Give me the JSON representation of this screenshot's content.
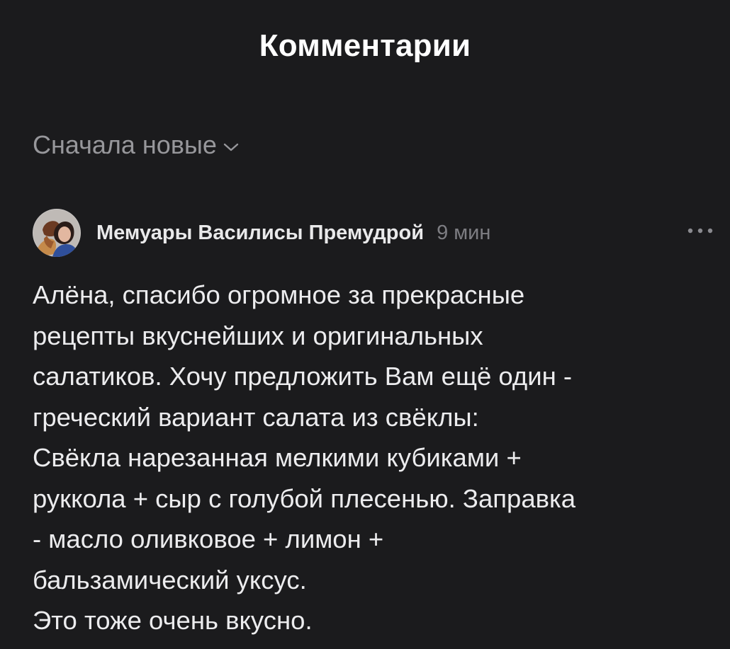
{
  "header": {
    "title": "Комментарии"
  },
  "sort": {
    "label": "Сначала новые",
    "icon": "chevron-down-icon"
  },
  "comment": {
    "author": "Мемуары Василисы Премудрой",
    "time": "9 мин",
    "avatar_icon": "user-avatar",
    "more_icon": "more-dots-icon",
    "lines": [
      "Алёна, спасибо огромное за прекрасные",
      "рецепты вкуснейших и оригинальных",
      "салатиков. Хочу предложить Вам ещё один -",
      "греческий вариант салата из свёклы:",
      "Свёкла нарезанная мелкими кубиками +",
      "руккола + сыр с голубой плесенью. Заправка",
      "- масло оливковое + лимон +",
      "бальзамический уксус.",
      "Это тоже очень вкусно."
    ]
  },
  "colors": {
    "background": "#1b1b1d",
    "title": "#ffffff",
    "text": "#ececee",
    "muted": "#97979b",
    "time": "#7d7d82"
  }
}
